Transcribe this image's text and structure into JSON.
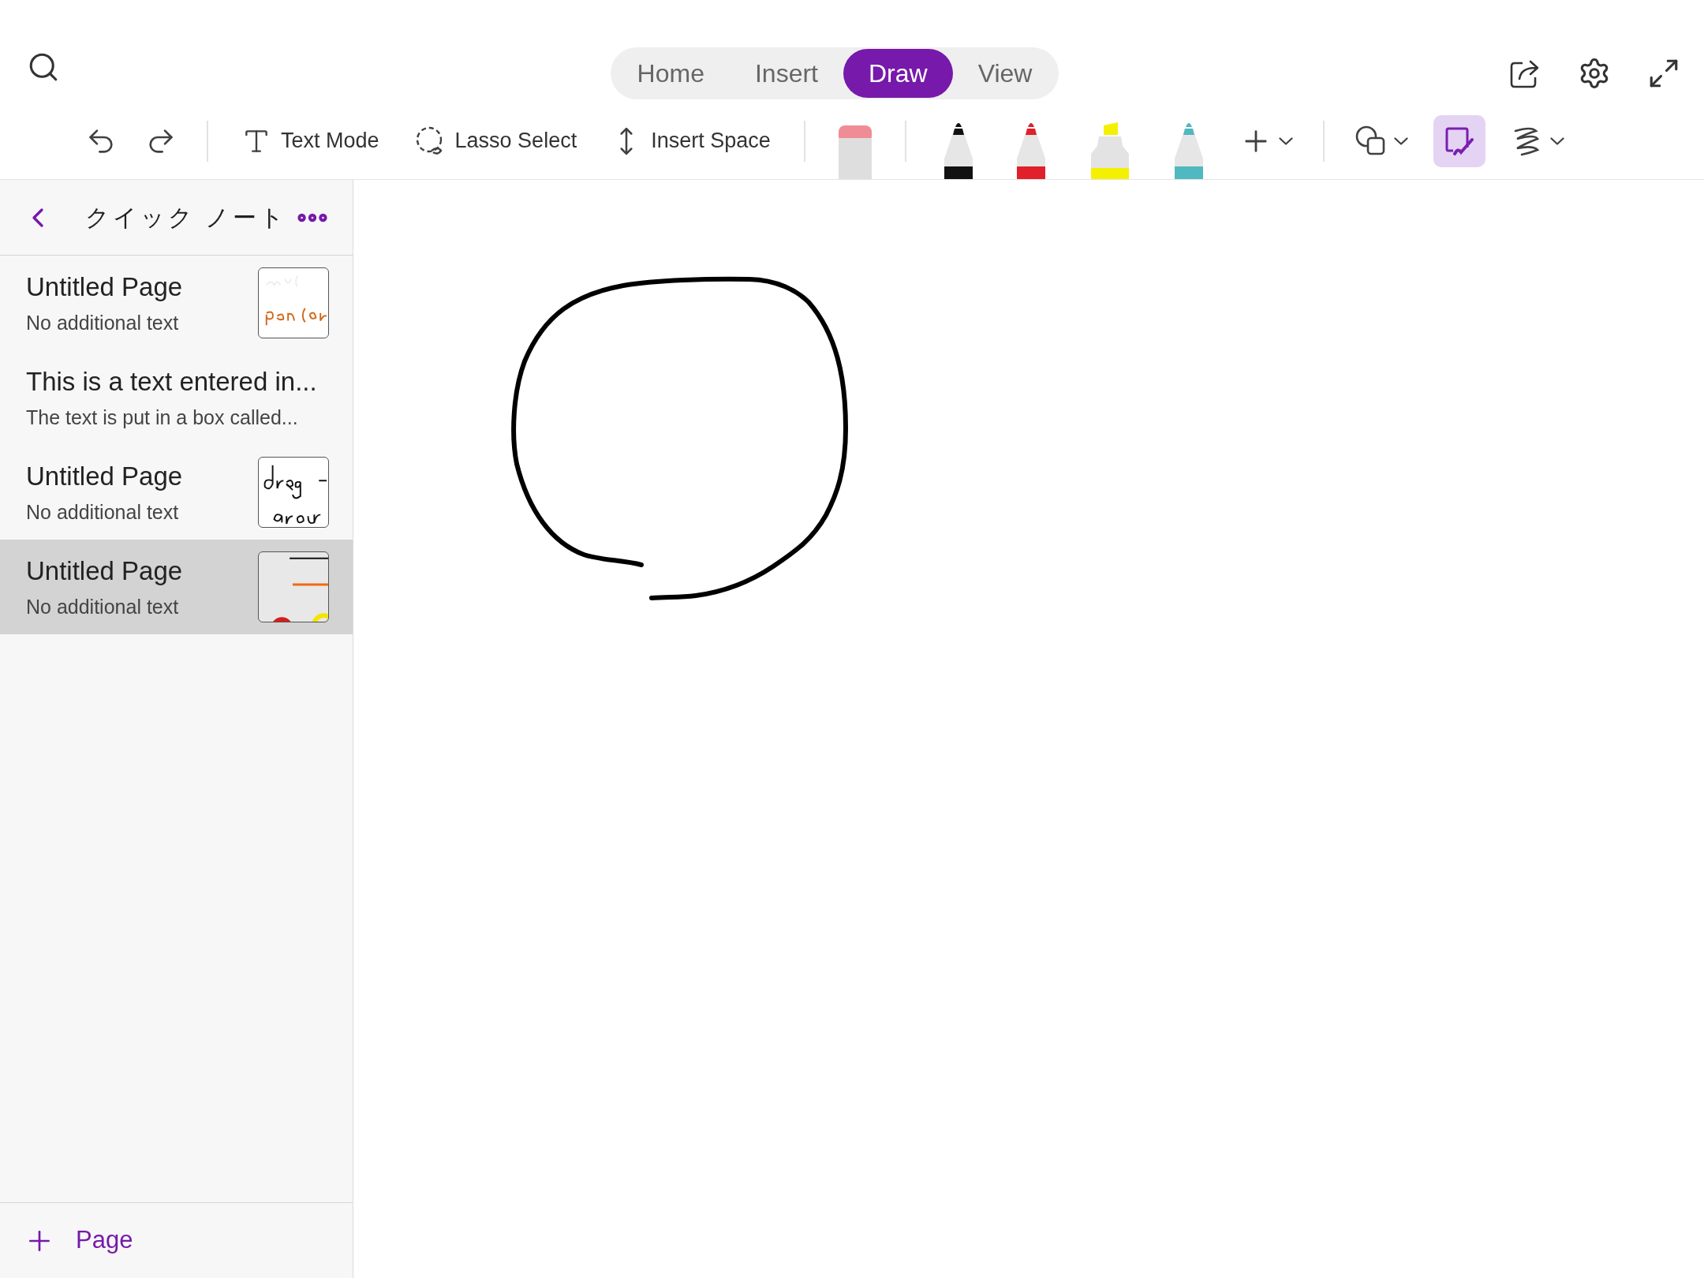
{
  "tabs": [
    {
      "label": "Home",
      "selected": false
    },
    {
      "label": "Insert",
      "selected": false
    },
    {
      "label": "Draw",
      "selected": true
    },
    {
      "label": "View",
      "selected": false
    }
  ],
  "toolbar": [
    {
      "kind": "undo"
    },
    {
      "kind": "redo"
    },
    {
      "kind": "divider"
    },
    {
      "kind": "text",
      "label": "Text Mode"
    },
    {
      "kind": "lasso",
      "label": "Lasso Select"
    },
    {
      "kind": "space",
      "label": "Insert Space"
    },
    {
      "kind": "divider"
    },
    {
      "kind": "eraser"
    },
    {
      "kind": "divider"
    },
    {
      "kind": "pen",
      "color": "#111111"
    },
    {
      "kind": "pen",
      "color": "#e0202a"
    },
    {
      "kind": "highlighter",
      "color": "#f5f000"
    },
    {
      "kind": "pen",
      "color": "#4fb8c0"
    },
    {
      "kind": "add"
    },
    {
      "kind": "divider"
    },
    {
      "kind": "shapes"
    },
    {
      "kind": "convert",
      "on": true
    },
    {
      "kind": "ink"
    }
  ],
  "sidebar": {
    "title": "クイック ノート",
    "pages": [
      {
        "title": "Untitled Page",
        "subtitle": "No additional text",
        "thumbnail": {
          "kind": "pen"
        },
        "selected": false
      },
      {
        "title": "This is a text entered in...",
        "subtitle": "The text is put in a box called...",
        "selected": false
      },
      {
        "title": "Untitled Page",
        "subtitle": "No additional text",
        "thumbnail": {
          "kind": "drag"
        },
        "selected": false
      },
      {
        "title": "Untitled Page",
        "subtitle": "No additional text",
        "thumbnail": {
          "kind": "shapes"
        },
        "selected": true
      }
    ],
    "add_page": "Page"
  }
}
